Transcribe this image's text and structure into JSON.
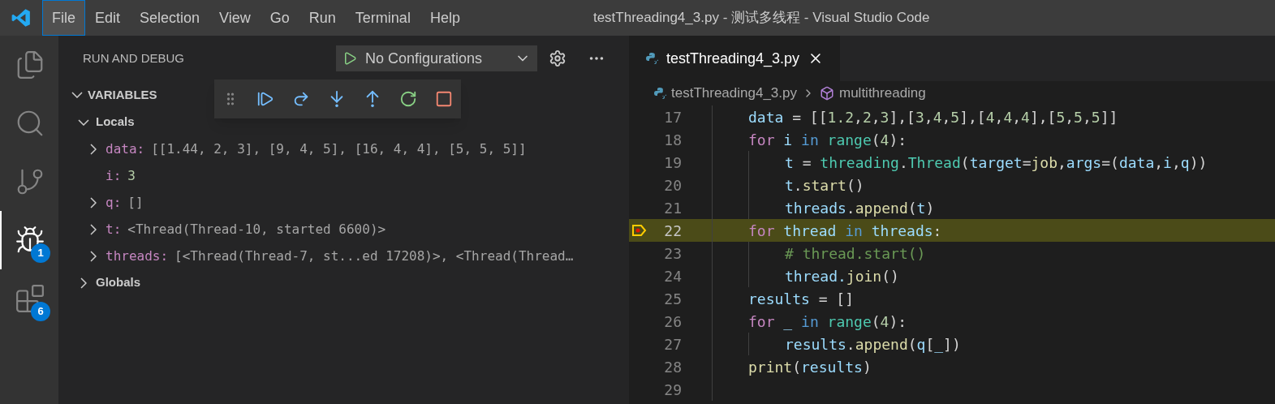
{
  "title_bar": {
    "menu": [
      {
        "label": "File",
        "selected": true
      },
      {
        "label": "Edit",
        "selected": false
      },
      {
        "label": "Selection",
        "selected": false
      },
      {
        "label": "View",
        "selected": false
      },
      {
        "label": "Go",
        "selected": false
      },
      {
        "label": "Run",
        "selected": false
      },
      {
        "label": "Terminal",
        "selected": false
      },
      {
        "label": "Help",
        "selected": false
      }
    ],
    "title": "testThreading4_3.py - 测试多线程 - Visual Studio Code"
  },
  "activity_bar": [
    {
      "selected": false
    },
    {
      "selected": false
    },
    {
      "selected": false
    },
    {
      "selected": true,
      "badge": "1"
    },
    {
      "selected": false,
      "badge": "6"
    }
  ],
  "sidebar": {
    "title": "RUN AND DEBUG",
    "configuration": "No Configurations",
    "section": "VARIABLES",
    "section_expanded": true,
    "scopes": [
      {
        "name": "Locals",
        "expanded": true,
        "variables": [
          {
            "name": "data:",
            "value": "[[1.44, 2, 3], [9, 4, 5], [16, 4, 4], [5, 5, 5]]",
            "expandable": true,
            "kind": "object"
          },
          {
            "name": "i:",
            "value": "3",
            "expandable": false,
            "kind": "number"
          },
          {
            "name": "q:",
            "value": "[]",
            "expandable": true,
            "kind": "object"
          },
          {
            "name": "t:",
            "value": "<Thread(Thread-10, started 6600)>",
            "expandable": true,
            "kind": "object"
          },
          {
            "name": "threads:",
            "value": "[<Thread(Thread-7, st...ed 17208)>, <Thread(Thread…",
            "expandable": true,
            "kind": "object"
          }
        ]
      },
      {
        "name": "Globals",
        "expanded": false
      }
    ]
  },
  "editor": {
    "tab": {
      "label": "testThreading4_3.py",
      "selected": true
    },
    "breadcrumb": [
      "testThreading4_3.py",
      "multithreading"
    ],
    "lines": [
      {
        "number": "17",
        "current": false,
        "tokens": [
          {
            "kind": "var",
            "text": "data"
          },
          {
            "kind": "punct",
            "text": " = [["
          },
          {
            "kind": "num",
            "text": "1.2"
          },
          {
            "kind": "punct",
            "text": ","
          },
          {
            "kind": "num",
            "text": "2"
          },
          {
            "kind": "punct",
            "text": ","
          },
          {
            "kind": "num",
            "text": "3"
          },
          {
            "kind": "punct",
            "text": "],["
          },
          {
            "kind": "num",
            "text": "3"
          },
          {
            "kind": "punct",
            "text": ","
          },
          {
            "kind": "num",
            "text": "4"
          },
          {
            "kind": "punct",
            "text": ","
          },
          {
            "kind": "num",
            "text": "5"
          },
          {
            "kind": "punct",
            "text": "],["
          },
          {
            "kind": "num",
            "text": "4"
          },
          {
            "kind": "punct",
            "text": ","
          },
          {
            "kind": "num",
            "text": "4"
          },
          {
            "kind": "punct",
            "text": ","
          },
          {
            "kind": "num",
            "text": "4"
          },
          {
            "kind": "punct",
            "text": "],["
          },
          {
            "kind": "num",
            "text": "5"
          },
          {
            "kind": "punct",
            "text": ","
          },
          {
            "kind": "num",
            "text": "5"
          },
          {
            "kind": "punct",
            "text": ","
          },
          {
            "kind": "num",
            "text": "5"
          },
          {
            "kind": "punct",
            "text": "]]"
          }
        ]
      },
      {
        "number": "18",
        "current": false,
        "tokens": [
          {
            "kind": "control",
            "text": "for"
          },
          {
            "kind": "var",
            "text": " i"
          },
          {
            "kind": "keyword",
            "text": " in"
          },
          {
            "kind": "class",
            "text": " range"
          },
          {
            "kind": "punct",
            "text": "("
          },
          {
            "kind": "num",
            "text": "4"
          },
          {
            "kind": "punct",
            "text": "):"
          }
        ],
        "children": [
          {
            "number": "19",
            "current": false,
            "tokens": [
              {
                "kind": "var",
                "text": "t"
              },
              {
                "kind": "punct",
                "text": " = "
              },
              {
                "kind": "class",
                "text": "threading"
              },
              {
                "kind": "punct",
                "text": "."
              },
              {
                "kind": "class",
                "text": "Thread"
              },
              {
                "kind": "punct",
                "text": "("
              },
              {
                "kind": "var",
                "text": "target"
              },
              {
                "kind": "punct",
                "text": "="
              },
              {
                "kind": "func",
                "text": "job"
              },
              {
                "kind": "punct",
                "text": ","
              },
              {
                "kind": "var",
                "text": "args"
              },
              {
                "kind": "punct",
                "text": "=("
              },
              {
                "kind": "var",
                "text": "data"
              },
              {
                "kind": "punct",
                "text": ","
              },
              {
                "kind": "var",
                "text": "i"
              },
              {
                "kind": "punct",
                "text": ","
              },
              {
                "kind": "var",
                "text": "q"
              },
              {
                "kind": "punct",
                "text": "))"
              }
            ]
          },
          {
            "number": "20",
            "current": false,
            "tokens": [
              {
                "kind": "var",
                "text": "t"
              },
              {
                "kind": "punct",
                "text": "."
              },
              {
                "kind": "func",
                "text": "start"
              },
              {
                "kind": "punct",
                "text": "()"
              }
            ]
          },
          {
            "number": "21",
            "current": false,
            "tokens": [
              {
                "kind": "var",
                "text": "threads"
              },
              {
                "kind": "punct",
                "text": "."
              },
              {
                "kind": "func",
                "text": "append"
              },
              {
                "kind": "punct",
                "text": "("
              },
              {
                "kind": "var",
                "text": "t"
              },
              {
                "kind": "punct",
                "text": ")"
              }
            ]
          }
        ]
      },
      {
        "number": "22",
        "current": true,
        "tokens": [
          {
            "kind": "control",
            "text": "for"
          },
          {
            "kind": "var",
            "text": " thread"
          },
          {
            "kind": "keyword",
            "text": " in"
          },
          {
            "kind": "var",
            "text": " threads"
          },
          {
            "kind": "punct",
            "text": ":"
          }
        ],
        "children": [
          {
            "number": "23",
            "current": false,
            "tokens": [
              {
                "kind": "comment",
                "text": "# thread.start()"
              }
            ]
          },
          {
            "number": "24",
            "current": false,
            "tokens": [
              {
                "kind": "var",
                "text": "thread."
              },
              {
                "kind": "func",
                "text": "join"
              },
              {
                "kind": "punct",
                "text": "()"
              }
            ]
          }
        ]
      },
      {
        "number": "25",
        "current": false,
        "tokens": [
          {
            "kind": "var",
            "text": "results"
          },
          {
            "kind": "punct",
            "text": " = []"
          }
        ]
      },
      {
        "number": "26",
        "current": false,
        "tokens": [
          {
            "kind": "control",
            "text": "for"
          },
          {
            "kind": "var",
            "text": " _"
          },
          {
            "kind": "keyword",
            "text": " in"
          },
          {
            "kind": "class",
            "text": " range"
          },
          {
            "kind": "punct",
            "text": "("
          },
          {
            "kind": "num",
            "text": "4"
          },
          {
            "kind": "punct",
            "text": "):"
          }
        ],
        "children": [
          {
            "number": "27",
            "current": false,
            "tokens": [
              {
                "kind": "var",
                "text": "results"
              },
              {
                "kind": "punct",
                "text": "."
              },
              {
                "kind": "func",
                "text": "append"
              },
              {
                "kind": "punct",
                "text": "("
              },
              {
                "kind": "var",
                "text": "q"
              },
              {
                "kind": "punct",
                "text": "["
              },
              {
                "kind": "var",
                "text": "_"
              },
              {
                "kind": "punct",
                "text": "])"
              }
            ]
          }
        ]
      },
      {
        "number": "28",
        "current": false,
        "tokens": [
          {
            "kind": "func",
            "text": "print"
          },
          {
            "kind": "punct",
            "text": "("
          },
          {
            "kind": "var",
            "text": "results"
          },
          {
            "kind": "punct",
            "text": ")"
          }
        ]
      },
      {
        "number": "29",
        "current": false
      }
    ]
  }
}
